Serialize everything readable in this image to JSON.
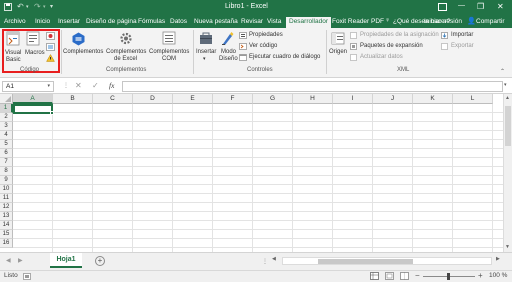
{
  "titlebar": {
    "title": "Libro1 - Excel",
    "min": "—",
    "max": "☐",
    "close": "✕",
    "restore": "❐"
  },
  "tabs": [
    "Archivo",
    "Inicio",
    "Insertar",
    "Diseño de página",
    "Fórmulas",
    "Datos",
    "Nueva pestaña",
    "Revisar",
    "Vista",
    "Desarrollador",
    "Foxit Reader PDF"
  ],
  "tell_me": "¿Qué desea hacer?",
  "sign_in": "Iniciar sesión",
  "share": "Compartir",
  "ribbon": {
    "codigo": {
      "visual_basic": "Visual",
      "visual_basic2": "Basic",
      "macros": "Macros",
      "group": "Código"
    },
    "complementos": {
      "complementos": "Complementos",
      "excel": "Complementos",
      "excel2": "de Excel",
      "com": "Complementos",
      "com2": "COM",
      "group": "Complementos"
    },
    "controles": {
      "insertar": "Insertar",
      "modo": "Modo",
      "modo2": "Diseño",
      "propiedades": "Propiedades",
      "ver_codigo": "Ver código",
      "ejecutar": "Ejecutar cuadro de diálogo",
      "group": "Controles"
    },
    "xml": {
      "origen": "Origen",
      "prop_asign": "Propiedades de la asignación",
      "paquetes": "Paquetes de expansión",
      "actualizar": "Actualizar datos",
      "importar": "Importar",
      "exportar": "Exportar",
      "group": "XML"
    }
  },
  "formula_bar": {
    "name_box": "A1",
    "fx": "fx",
    "cancel": "✕",
    "enter": "✓",
    "value": ""
  },
  "columns": [
    "A",
    "B",
    "C",
    "D",
    "E",
    "F",
    "G",
    "H",
    "I",
    "J",
    "K",
    "L"
  ],
  "rows": [
    "1",
    "2",
    "3",
    "4",
    "5",
    "6",
    "7",
    "8",
    "9",
    "10",
    "11",
    "12",
    "13",
    "14",
    "15",
    "16"
  ],
  "sheet_tab": "Hoja1",
  "status": {
    "ready": "Listo",
    "zoom": "100 %",
    "zoom_minus": "−",
    "zoom_plus": "+"
  },
  "colors": {
    "brand": "#217346",
    "highlight": "#e81e1e"
  }
}
